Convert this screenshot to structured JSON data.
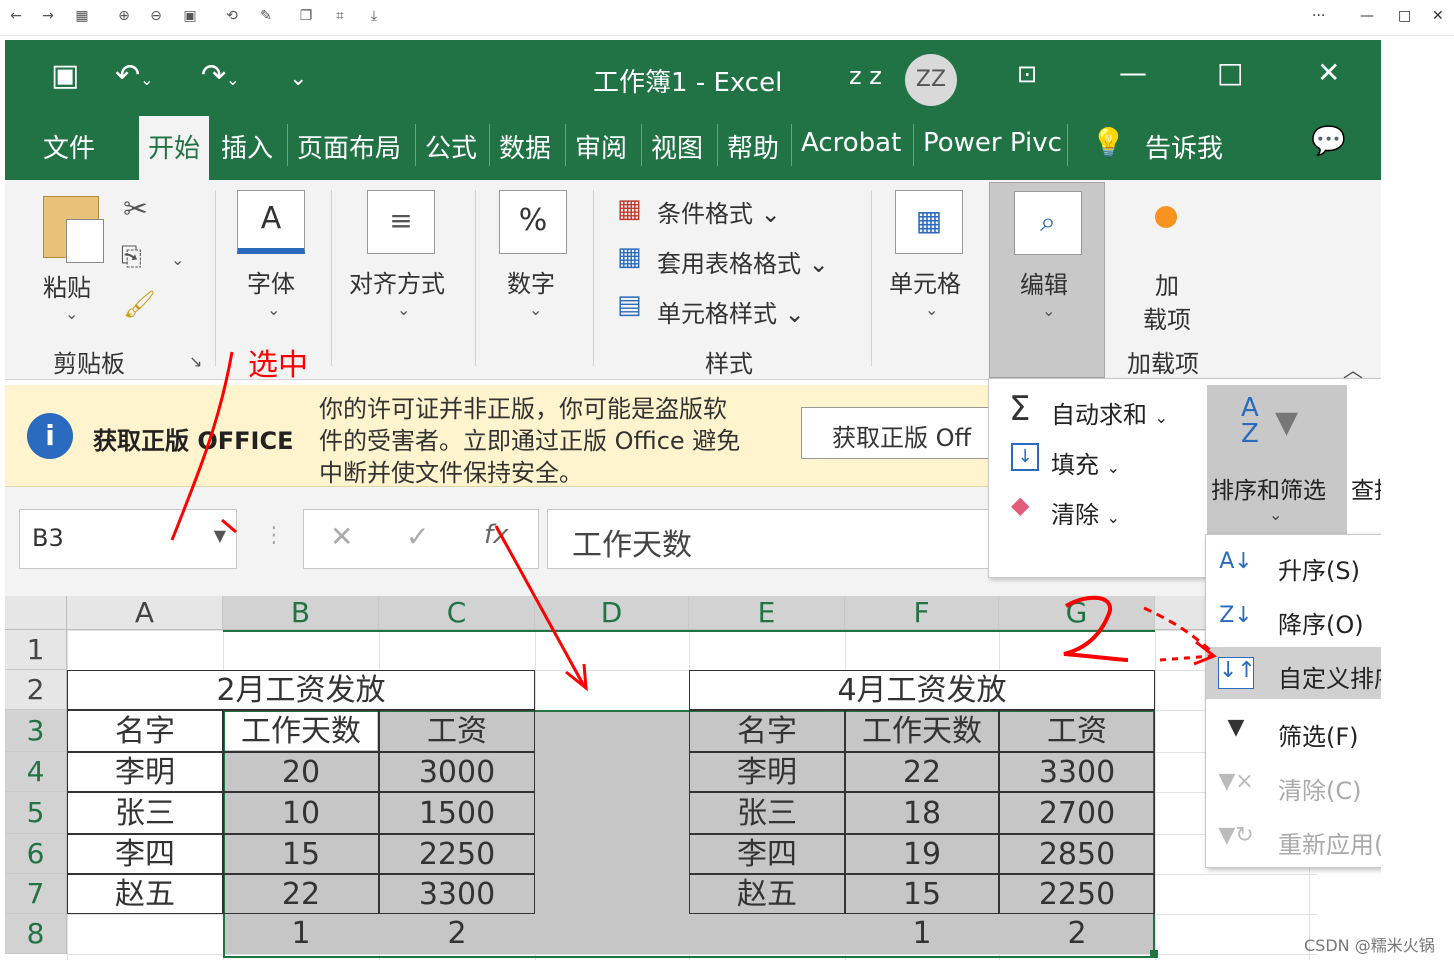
{
  "window": {
    "title": "工作簿1  -  Excel",
    "user": "z z",
    "avatar": "ZZ"
  },
  "tabs": {
    "file": "文件",
    "home": "开始",
    "insert": "插入",
    "layout": "页面布局",
    "formulas": "公式",
    "data": "数据",
    "review": "审阅",
    "view": "视图",
    "help": "帮助",
    "acrobat": "Acrobat",
    "powerpivot": "Power Pivc",
    "tellme": "告诉我"
  },
  "ribbon": {
    "paste": "粘贴",
    "clipboard": "剪贴板",
    "font": "字体",
    "align": "对齐方式",
    "number": "数字",
    "cond_format": "条件格式",
    "table_format": "套用表格格式",
    "cell_style": "单元格样式",
    "styles": "样式",
    "cells": "单元格",
    "editing": "编辑",
    "addin_line1": "加",
    "addin_line2": "载项",
    "addins": "加载项"
  },
  "infobar": {
    "title": "获取正版 OFFICE",
    "line1": "你的许可证并非正版，你可能是盗版软",
    "line2": "件的受害者。立即通过正版 Office 避免",
    "line3": "中断并使文件保持安全。",
    "button": "获取正版 Off"
  },
  "formula": {
    "namebox": "B3",
    "content": "工作天数"
  },
  "editmenu": {
    "autosum": "自动求和",
    "fill": "填充",
    "clear": "清除",
    "sortfilter": "排序和筛选",
    "findselect": "查找和选"
  },
  "sortmenu": {
    "asc": "升序(S)",
    "desc": "降序(O)",
    "custom": "自定义排序(U)...",
    "filter": "筛选(F)",
    "clear": "清除(C)",
    "reapply": "重新应用(Y)"
  },
  "columns": [
    "A",
    "B",
    "C",
    "D",
    "E",
    "F",
    "G"
  ],
  "rows": [
    "1",
    "2",
    "3",
    "4",
    "5",
    "6",
    "7",
    "8"
  ],
  "table1": {
    "title": "2月工资发放",
    "headers": [
      "名字",
      "工作天数",
      "工资"
    ],
    "rows": [
      [
        "李明",
        "20",
        "3000"
      ],
      [
        "张三",
        "10",
        "1500"
      ],
      [
        "李四",
        "15",
        "2250"
      ],
      [
        "赵五",
        "22",
        "3300"
      ]
    ],
    "extra": [
      "1",
      "2"
    ]
  },
  "table2": {
    "title": "4月工资发放",
    "headers": [
      "名字",
      "工作天数",
      "工资"
    ],
    "rows": [
      [
        "李明",
        "22",
        "3300"
      ],
      [
        "张三",
        "18",
        "2700"
      ],
      [
        "李四",
        "19",
        "2850"
      ],
      [
        "赵五",
        "15",
        "2250"
      ]
    ],
    "extra": [
      "1",
      "2"
    ]
  },
  "annotations": {
    "select": "选中"
  },
  "watermark": "CSDN @糯米火锅",
  "colors": {
    "excel_green": "#217346",
    "selection": "#c6c6c6",
    "annotation": "#ff0000"
  }
}
